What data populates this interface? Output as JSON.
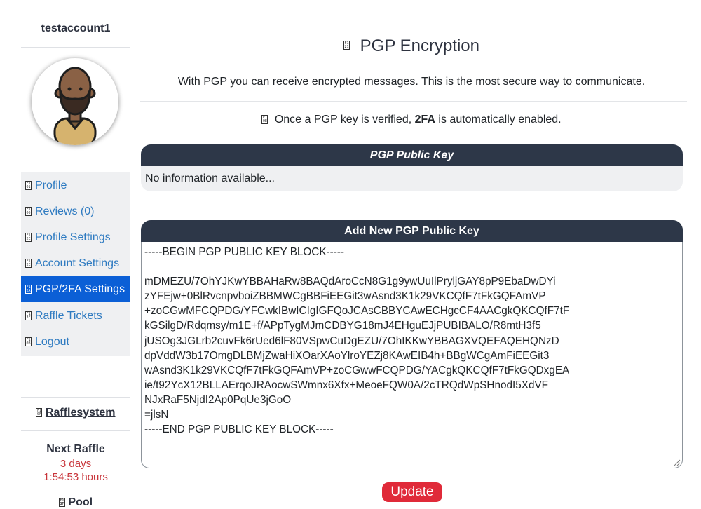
{
  "sidebar": {
    "username": "testaccount1",
    "nav": [
      {
        "label": "Profile",
        "glyph": "F1 01",
        "icon": "profile-icon"
      },
      {
        "label": "Reviews (0)",
        "glyph": "F1 06",
        "icon": "reviews-icon"
      },
      {
        "label": "Profile Settings",
        "glyph": "F1 2E",
        "icon": "profile-settings-icon"
      },
      {
        "label": "Account Settings",
        "glyph": "F1 2E",
        "icon": "account-settings-icon"
      },
      {
        "label": "PGP/2FA Settings",
        "glyph": "F1 2A",
        "icon": "pgp-icon"
      },
      {
        "label": "Raffle Tickets",
        "glyph": "F1 3F",
        "icon": "raffle-ticket-icon"
      },
      {
        "label": "Logout",
        "glyph": "F1 0B",
        "icon": "logout-icon"
      }
    ],
    "active_index": 4,
    "raffle": {
      "title": "Rafflesystem",
      "title_glyph": "F1 0F",
      "next_label": "Next Raffle",
      "days": "3 days",
      "time": "1:54:53 hours",
      "pool_label": "Pool",
      "pool_glyph": "F1 3F"
    }
  },
  "main": {
    "title": "PGP Encryption",
    "title_glyph": "F1 21",
    "intro": "With PGP you can receive encrypted messages. This is the most secure way to communicate.",
    "notice_glyph": "F1 0E",
    "notice_prefix": "Once a PGP key is verified, ",
    "notice_bold": "2FA",
    "notice_suffix": " is automatically enabled.",
    "public_key_card": {
      "header": "PGP Public Key",
      "body": "No information available..."
    },
    "add_key_card": {
      "header": "Add New PGP Public Key",
      "key_text": "-----BEGIN PGP PUBLIC KEY BLOCK-----\n\nmDMEZU/7OhYJKwYBBAHaRw8BAQdAroCcN8G1g9ywUuIlPryljGAY8pP9EbaDwDYi\nzYFEjw+0BlRvcnpvboiZBBMWCgBBFiEEGit3wAsnd3K1k29VKCQfF7tFkGQFAmVP\n+zoCGwMFCQPDG/YFCwkIBwICIgIGFQoJCAsCBBYCAwECHgcCF4AACgkQKCQfF7tF\nkGSilgD/Rdqmsy/m1E+f/APpTygMJmCDBYG18mJ4EHguEJjPUBIBALO/R8mtH3f5\njUSOg3JGLrb2cuvFk6rUed6lF80VSpwCuDgEZU/7OhIKKwYBBAGXVQEFAQEHQNzD\ndpVddW3b17OmgDLBMjZwaHiXOarXAoYlroYEZj8KAwEIB4h+BBgWCgAmFiEEGit3\nwAsnd3K1k29VKCQfF7tFkGQFAmVP+zoCGwwFCQPDG/YACgkQKCQfF7tFkGQDxgEA\nie/t92YcX12BLLAErqoJRAocwSWmnx6Xfx+MeoeFQW0A/2cTRQdWpSHnodI5XdVF\nNJxRaF5NjdI2Ap0PqUe3jGoO\n=jlsN\n-----END PGP PUBLIC KEY BLOCK-----"
    },
    "update_label": "Update"
  }
}
